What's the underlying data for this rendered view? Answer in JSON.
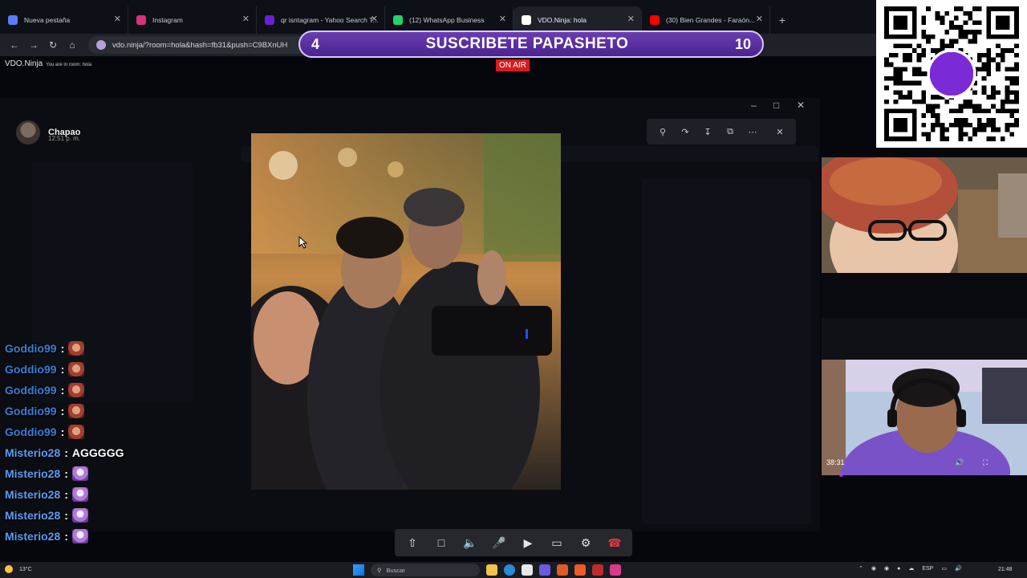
{
  "browser": {
    "tabs": [
      {
        "label": "Nueva pestaña",
        "icon": "globe-icon",
        "color": "#5b7cfa",
        "active": false
      },
      {
        "label": "Instagram",
        "icon": "instagram-icon",
        "color": "#d9307a",
        "active": false
      },
      {
        "label": "qr isntagram - Yahoo Search T...",
        "icon": "yahoo-icon",
        "color": "#6a1fd1",
        "active": false
      },
      {
        "label": "(12) WhatsApp Business",
        "icon": "whatsapp-icon",
        "color": "#25d366",
        "active": false
      },
      {
        "label": "VDO.Ninja: hola",
        "icon": "vdoninja-icon",
        "color": "#ffffff",
        "active": true
      },
      {
        "label": "(30) Bien Grandes - Faraón...",
        "icon": "youtube-icon",
        "color": "#ff0000",
        "active": false
      }
    ],
    "url": "vdo.ninja/?room=hola&hash=fb31&push=C9BXnUH"
  },
  "vdo": {
    "title": "VDO.Ninja",
    "room_text": "You are in room: hola",
    "on_air": "ON AIR"
  },
  "banner": {
    "left": "4",
    "text": "SUSCRIBETE PAPASHETO",
    "right": "10"
  },
  "viewer": {
    "user": "Chapao",
    "time": "12:51 p. m."
  },
  "chat": [
    {
      "user": "Goddio99",
      "text": "",
      "emote": "red"
    },
    {
      "user": "Goddio99",
      "text": "",
      "emote": "red"
    },
    {
      "user": "Goddio99",
      "text": "",
      "emote": "red"
    },
    {
      "user": "Goddio99",
      "text": "",
      "emote": "red"
    },
    {
      "user": "Goddio99",
      "text": "",
      "emote": "red"
    },
    {
      "user": "Misterio28",
      "text": "AGGGGG",
      "emote": ""
    },
    {
      "user": "Misterio28",
      "text": "",
      "emote": "purple"
    },
    {
      "user": "Misterio28",
      "text": "",
      "emote": "purple"
    },
    {
      "user": "Misterio28",
      "text": "",
      "emote": "purple"
    },
    {
      "user": "Misterio28",
      "text": "",
      "emote": "purple"
    }
  ],
  "cam2": {
    "time": "38:31"
  },
  "taskbar": {
    "temp": "13°C",
    "search": "Buscar",
    "lang": "ESP",
    "clock": "21:48"
  }
}
